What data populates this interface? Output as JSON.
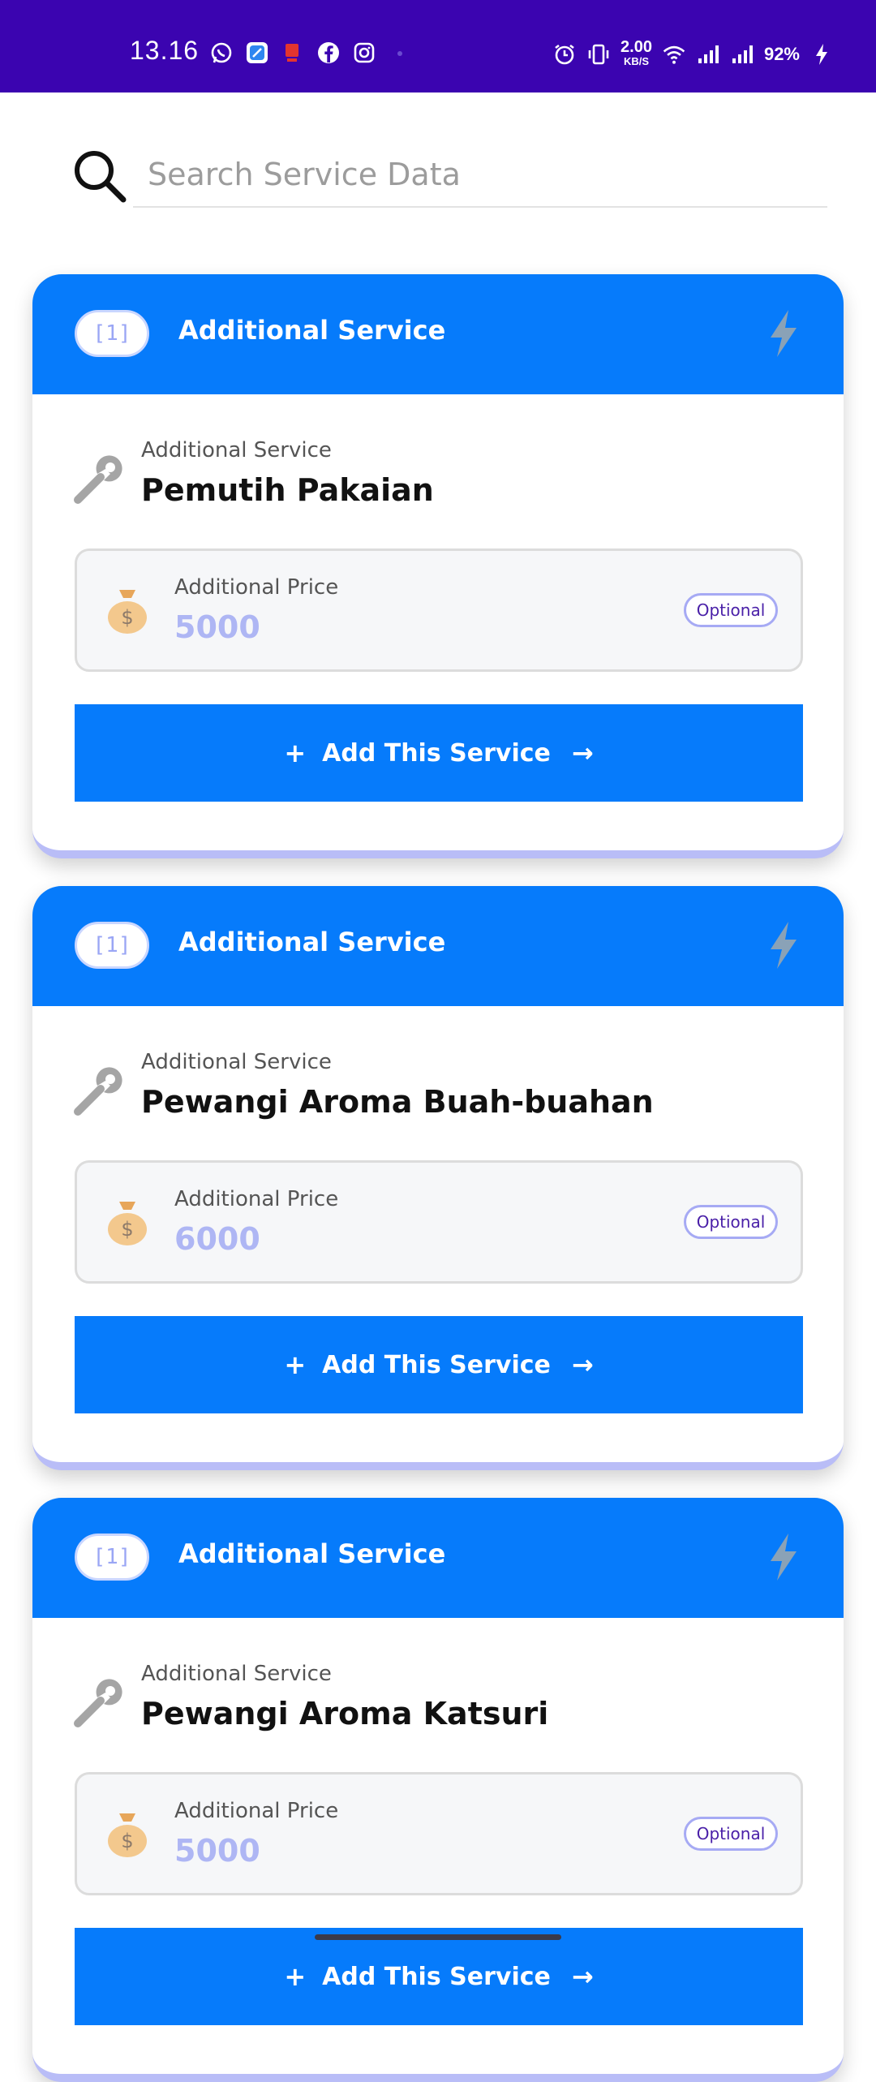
{
  "status_bar": {
    "time": "13.16",
    "net_speed_value": "2.00",
    "net_speed_unit": "KB/S",
    "battery": "92%",
    "background_color": "#3b04b0",
    "left_icons": [
      "whatsapp-icon",
      "app-icon",
      "pay-app-icon",
      "facebook-icon",
      "instagram-icon",
      "dot-icon"
    ],
    "right_icons": [
      "alarm-icon",
      "vibrate-icon",
      "wifi-icon",
      "signal-icon",
      "signal-icon",
      "charging-icon"
    ]
  },
  "search": {
    "placeholder": "Search Service Data",
    "value": ""
  },
  "colors": {
    "primary_blue": "#067bfb",
    "price_text": "#aeb6f4",
    "optional_border": "#a6aaf4",
    "card_bottom_accent": "#b9bdf7"
  },
  "cards": [
    {
      "index": "[1]",
      "header_title": "Additional Service",
      "service_caption": "Additional Service",
      "service_name": "Pemutih Pakaian",
      "price_label": "Additional Price",
      "price_value": "5000",
      "badge": "Optional",
      "button_plus": "+",
      "button_label": "Add This Service",
      "button_arrow": "→"
    },
    {
      "index": "[1]",
      "header_title": "Additional Service",
      "service_caption": "Additional Service",
      "service_name": "Pewangi Aroma Buah-buahan",
      "price_label": "Additional Price",
      "price_value": "6000",
      "badge": "Optional",
      "button_plus": "+",
      "button_label": "Add This Service",
      "button_arrow": "→"
    },
    {
      "index": "[1]",
      "header_title": "Additional Service",
      "service_caption": "Additional Service",
      "service_name": "Pewangi Aroma Katsuri",
      "price_label": "Additional Price",
      "price_value": "5000",
      "badge": "Optional",
      "button_plus": "+",
      "button_label": "Add This Service",
      "button_arrow": "→"
    }
  ]
}
